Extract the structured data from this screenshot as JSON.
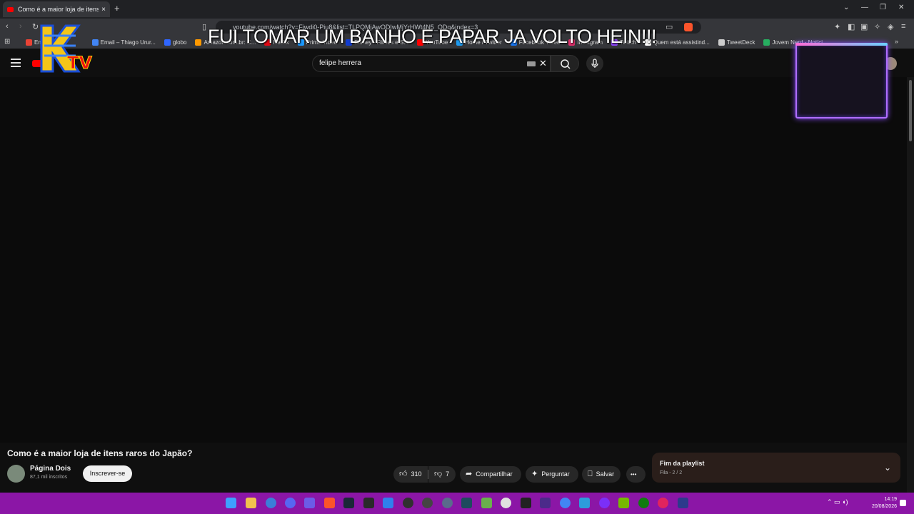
{
  "browser": {
    "tab_title": "Como é a maior loja de itens raros",
    "tab_close": "×",
    "new_tab": "+",
    "url": "youtube.com/watch?v=Fjwdi0-Piu8&list=TLPQMjAwODIwMjYrHWt4N5_ODg&index=3",
    "bookmarks": [
      {
        "label": "Em...",
        "color": "#ea4335"
      },
      {
        "label": "Email – Thiago Urur...",
        "color": "#4285f4"
      },
      {
        "label": "globo",
        "color": "#2f66ff"
      },
      {
        "label": "Amazon.com.br: C...",
        "color": "#ff9900"
      },
      {
        "label": "Netflix",
        "color": "#e50914"
      },
      {
        "label": "Prime Video",
        "color": "#1a98ff"
      },
      {
        "label": "Disney+ Filmes e S...",
        "color": "#113ccf"
      },
      {
        "label": "YouTube",
        "color": "#ff0000"
      },
      {
        "label": "Home / Twitter",
        "color": "#1d9bf0"
      },
      {
        "label": "Facebook Video",
        "color": "#1877f2"
      },
      {
        "label": "Instagram",
        "color": "#e1306c"
      },
      {
        "label": "Twitch",
        "color": "#9146ff"
      },
      {
        "label": "Quem está assistind...",
        "color": "#ffffff"
      },
      {
        "label": "TweetDeck",
        "color": "#cccccc"
      },
      {
        "label": "Jovem Nerd - Notíci...",
        "color": "#27ae60"
      }
    ]
  },
  "overlay": {
    "text": "FUI TOMAR UM BANHO E PAPAR JA VOLTO HEIN!!!",
    "logo_text": "TV"
  },
  "youtube": {
    "search_value": "felipe herrera",
    "clear": "✕",
    "video_title": "Como é a maior loja de itens raros do Japão?",
    "channel_name": "Página Dois",
    "subscribers": "87,1 mil inscritos",
    "subscribe_label": "Inscrever-se",
    "likes": "310",
    "dislikes": "7",
    "share_label": "Compartilhar",
    "ask_label": "Perguntar",
    "save_label": "Salvar",
    "more_label": "•••",
    "playlist_title": "Fim da playlist",
    "playlist_sub": "Fila - 2 / 2"
  },
  "taskbar": {
    "time": "14:19",
    "date": "20/08/2026",
    "accent": "#8b16a6",
    "apps": [
      "windows",
      "explorer",
      "qbittorrent",
      "discord",
      "obs",
      "brave",
      "steam",
      "epic",
      "vscode",
      "obs-studio",
      "obs-ctrl",
      "settings",
      "terminal",
      "notepad",
      "ccleaner",
      "dev",
      "xbox-nvidia",
      "chrome",
      "vpn",
      "vstudio",
      "nvidia",
      "xbox",
      "spotify",
      "r-app"
    ]
  }
}
